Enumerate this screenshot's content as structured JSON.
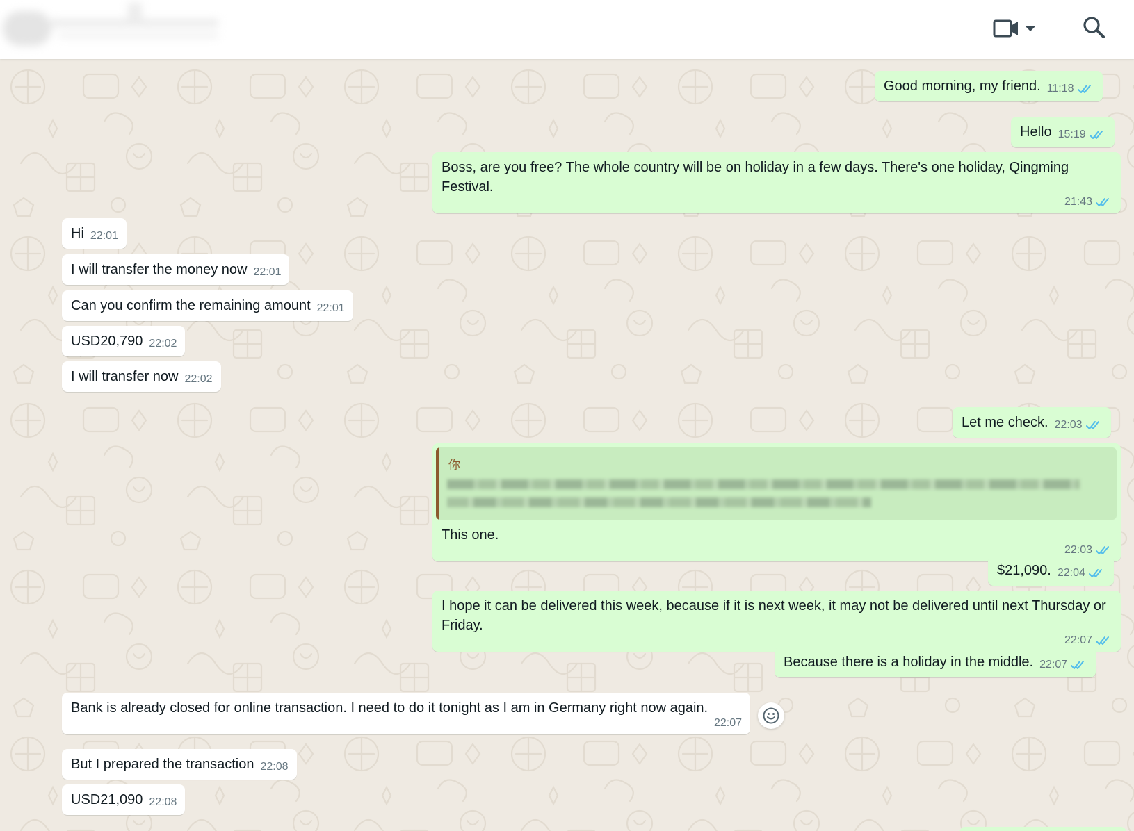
{
  "header": {
    "contact_name": "",
    "icons": {
      "video_call": "video-camera-icon",
      "dropdown": "caret-down-icon",
      "search": "search-icon"
    }
  },
  "colors": {
    "outgoing_bubble": "#d9fdd3",
    "incoming_bubble": "#ffffff",
    "chat_background": "#efeae2",
    "read_ticks": "#53bdeb",
    "quote_author": "#8c5a2e",
    "timestamp": "#667781"
  },
  "messages": [
    {
      "direction": "out",
      "text": "Good morning, my friend.",
      "time": "11:18",
      "status": "read"
    },
    {
      "direction": "out",
      "text": "Hello",
      "time": "15:19",
      "status": "read"
    },
    {
      "direction": "out",
      "text": "Boss, are you free? The whole country will be on holiday in a few days. There's one holiday, Qingming Festival.",
      "time": "21:43",
      "status": "read"
    },
    {
      "direction": "in",
      "text": "Hi",
      "time": "22:01"
    },
    {
      "direction": "in",
      "text": "I will transfer the money now",
      "time": "22:01"
    },
    {
      "direction": "in",
      "text": "Can you confirm the remaining amount",
      "time": "22:01"
    },
    {
      "direction": "in",
      "text": "USD20,790",
      "time": "22:02"
    },
    {
      "direction": "in",
      "text": "I will transfer now",
      "time": "22:02"
    },
    {
      "direction": "out",
      "text": "Let me check.",
      "time": "22:03",
      "status": "read"
    },
    {
      "direction": "out",
      "quote_author": "你",
      "text": "This one.",
      "time": "22:03",
      "status": "read"
    },
    {
      "direction": "out",
      "text": "$21,090.",
      "time": "22:04",
      "status": "read"
    },
    {
      "direction": "out",
      "text": "I hope it can be delivered this week, because if it is next week, it may not be delivered until next Thursday or Friday.",
      "time": "22:07",
      "status": "read"
    },
    {
      "direction": "out",
      "text": "Because there is a holiday in the middle.",
      "time": "22:07",
      "status": "read"
    },
    {
      "direction": "in",
      "text": "Bank is already closed for online transaction. I need to do it tonight as I am in Germany right now again.",
      "time": "22:07"
    },
    {
      "direction": "in",
      "text": "But I prepared the transaction",
      "time": "22:08"
    },
    {
      "direction": "in",
      "text": "USD21,090",
      "time": "22:08"
    }
  ],
  "reaction_button": {
    "icon": "smiley-icon"
  }
}
